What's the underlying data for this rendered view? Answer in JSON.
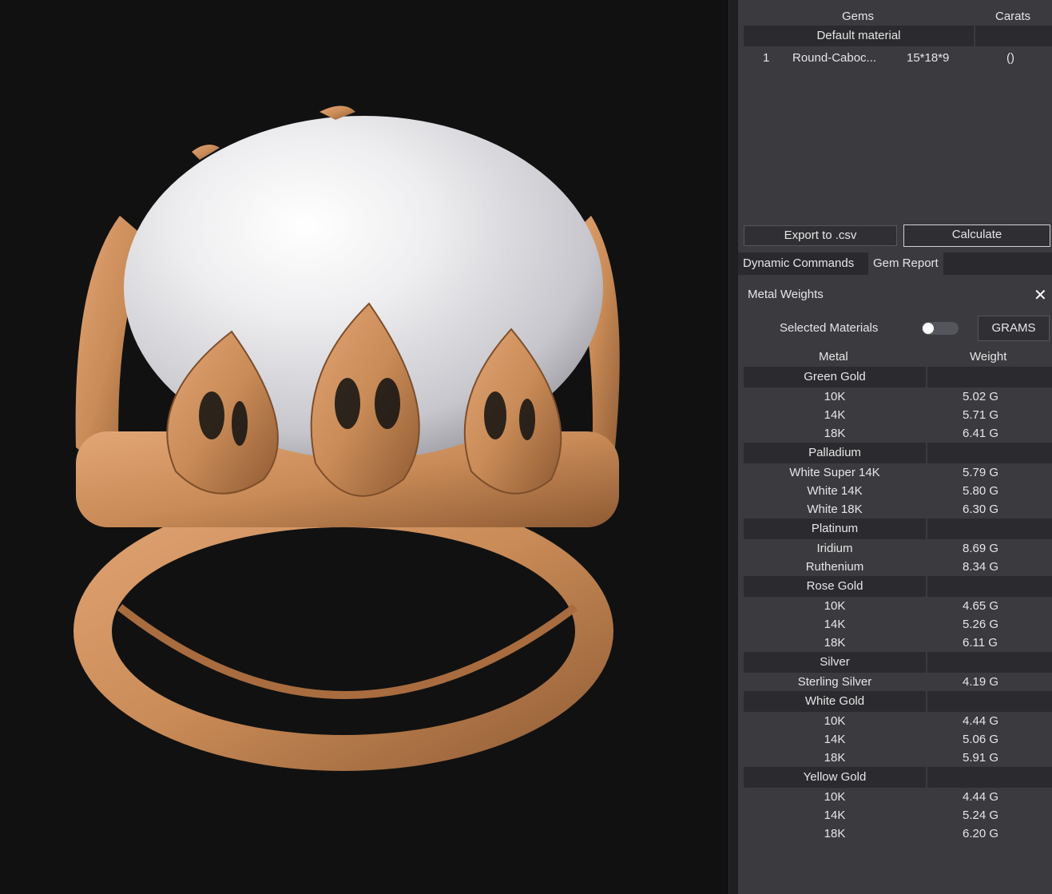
{
  "gems_table": {
    "headers": {
      "gems": "Gems",
      "carats": "Carats"
    },
    "group": "Default material",
    "rows": [
      {
        "index": "1",
        "name": "Round-Caboc...",
        "size": "15*18*9",
        "carats": "()"
      }
    ]
  },
  "buttons": {
    "export": "Export to .csv",
    "calculate": "Calculate"
  },
  "tabs": [
    {
      "label": "Dynamic Commands",
      "active": false
    },
    {
      "label": "Gem Report",
      "active": true
    }
  ],
  "metal_weights": {
    "title": "Metal Weights",
    "selected_materials_label": "Selected Materials",
    "selected_materials_on": false,
    "unit_button": "GRAMS",
    "headers": {
      "metal": "Metal",
      "weight": "Weight"
    },
    "groups": [
      {
        "name": "Green Gold",
        "rows": [
          {
            "metal": "10K",
            "weight": "5.02 G"
          },
          {
            "metal": "14K",
            "weight": "5.71 G"
          },
          {
            "metal": "18K",
            "weight": "6.41 G"
          }
        ]
      },
      {
        "name": "Palladium",
        "rows": [
          {
            "metal": "White Super 14K",
            "weight": "5.79 G"
          },
          {
            "metal": "White 14K",
            "weight": "5.80 G"
          },
          {
            "metal": "White 18K",
            "weight": "6.30 G"
          }
        ]
      },
      {
        "name": "Platinum",
        "rows": [
          {
            "metal": "Iridium",
            "weight": "8.69 G"
          },
          {
            "metal": "Ruthenium",
            "weight": "8.34 G"
          }
        ]
      },
      {
        "name": "Rose Gold",
        "rows": [
          {
            "metal": "10K",
            "weight": "4.65 G"
          },
          {
            "metal": "14K",
            "weight": "5.26 G"
          },
          {
            "metal": "18K",
            "weight": "6.11 G"
          }
        ]
      },
      {
        "name": "Silver",
        "rows": [
          {
            "metal": "Sterling Silver",
            "weight": "4.19 G"
          }
        ]
      },
      {
        "name": "White Gold",
        "rows": [
          {
            "metal": "10K",
            "weight": "4.44 G"
          },
          {
            "metal": "14K",
            "weight": "5.06 G"
          },
          {
            "metal": "18K",
            "weight": "5.91 G"
          }
        ]
      },
      {
        "name": "Yellow Gold",
        "rows": [
          {
            "metal": "10K",
            "weight": "4.44 G"
          },
          {
            "metal": "14K",
            "weight": "5.24 G"
          },
          {
            "metal": "18K",
            "weight": "6.20 G"
          }
        ]
      }
    ]
  },
  "colors": {
    "metal": "#c98b57",
    "stone": "#e9e9eb",
    "viewport_bg": "#111111",
    "panel_bg": "#3a3a3f"
  }
}
